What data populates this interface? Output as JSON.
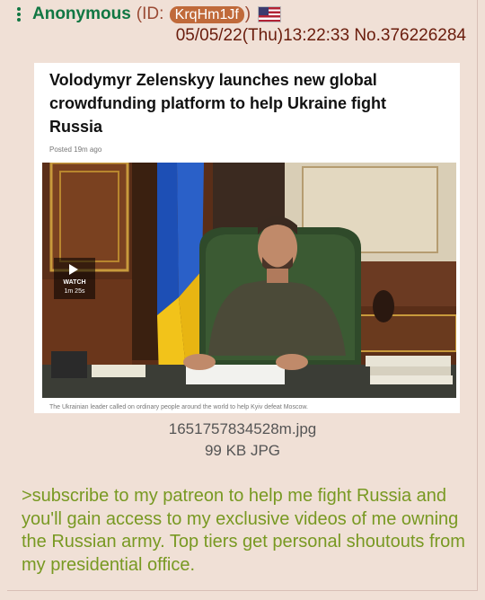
{
  "post": {
    "name": "Anonymous",
    "id_prefix": "(ID: ",
    "id": "KrqHm1Jf",
    "id_suffix": ")",
    "flag": "us-flag-icon",
    "datetime": "05/05/22(Thu)13:22:33",
    "number": "No.376226284"
  },
  "article": {
    "headline": "Volodymyr Zelenskyy launches new global crowdfunding platform to help Ukraine fight Russia",
    "posted": "Posted 19m ago",
    "watch_label": "WATCH",
    "watch_duration": "1m 25s",
    "caption": "The Ukrainian leader called on ordinary people around the world to help Kyiv defeat Moscow."
  },
  "file": {
    "name": "1651757834528m.jpg",
    "size": "99 KB JPG"
  },
  "message": ">subscribe to my patreon to help me fight Russia and you'll gain access to my exclusive videos of me owning the Russian army. Top tiers get personal shoutouts from my presidential office.",
  "colors": {
    "post_bg": "#f0e0d6",
    "name": "#117743",
    "greentext": "#789922",
    "id_badge": "#c06a3a"
  }
}
